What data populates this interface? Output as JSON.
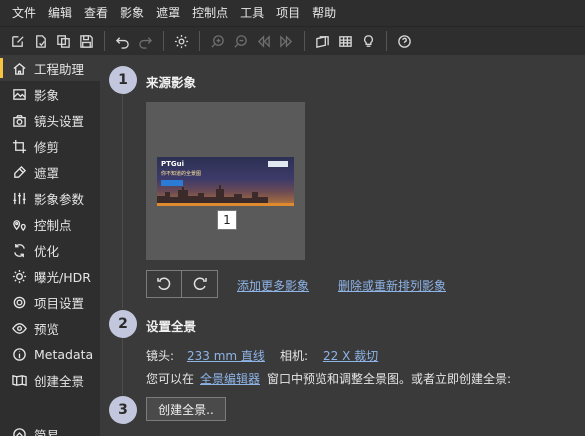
{
  "menubar": {
    "items": [
      "文件",
      "编辑",
      "查看",
      "影象",
      "遮罩",
      "控制点",
      "工具",
      "项目",
      "帮助"
    ]
  },
  "toolbar": {
    "icons": [
      "new-project-icon",
      "open-icon",
      "copy-icon",
      "save-icon",
      "undo-icon",
      "redo-icon",
      "settings-icon",
      "zoom-in-icon",
      "zoom-out-icon",
      "rewind-icon",
      "fast-forward-icon",
      "panorama-editor-icon",
      "grid-icon",
      "bulb-icon",
      "help-icon"
    ]
  },
  "sidebar": {
    "items": [
      {
        "label": "工程助理",
        "icon": "home-icon",
        "active": true
      },
      {
        "label": "影象",
        "icon": "image-icon"
      },
      {
        "label": "镜头设置",
        "icon": "camera-icon"
      },
      {
        "label": "修剪",
        "icon": "crop-icon"
      },
      {
        "label": "遮罩",
        "icon": "mask-icon"
      },
      {
        "label": "影象参数",
        "icon": "sliders-icon"
      },
      {
        "label": "控制点",
        "icon": "control-points-icon"
      },
      {
        "label": "优化",
        "icon": "optimize-icon"
      },
      {
        "label": "曝光/HDR",
        "icon": "sun-icon"
      },
      {
        "label": "项目设置",
        "icon": "gear-icon"
      },
      {
        "label": "预览",
        "icon": "eye-icon"
      },
      {
        "label": "Metadata",
        "icon": "info-icon"
      },
      {
        "label": "创建全景",
        "icon": "panorama-icon"
      }
    ],
    "bottom": {
      "label": "简易",
      "icon": "chevron-up-icon"
    }
  },
  "main": {
    "step1": {
      "num": "1",
      "title": "来源影象"
    },
    "image": {
      "index": "1",
      "pano_title": "PTGui",
      "pano_subtitle": "你不知道的全景图"
    },
    "links": {
      "add_more": "添加更多影象",
      "remove_reorder": "删除或重新排列影象"
    },
    "step2": {
      "num": "2",
      "title": "设置全景"
    },
    "lens": {
      "label": "镜头:",
      "value": "233 mm 直线",
      "camera_label": "相机:",
      "camera_value": "22 X 裁切"
    },
    "info": {
      "prefix": "您可以在",
      "link": "全景编辑器",
      "suffix": "窗口中预览和调整全景图。或者立即创建全景:"
    },
    "step3": {
      "num": "3",
      "button": "创建全景.."
    }
  }
}
